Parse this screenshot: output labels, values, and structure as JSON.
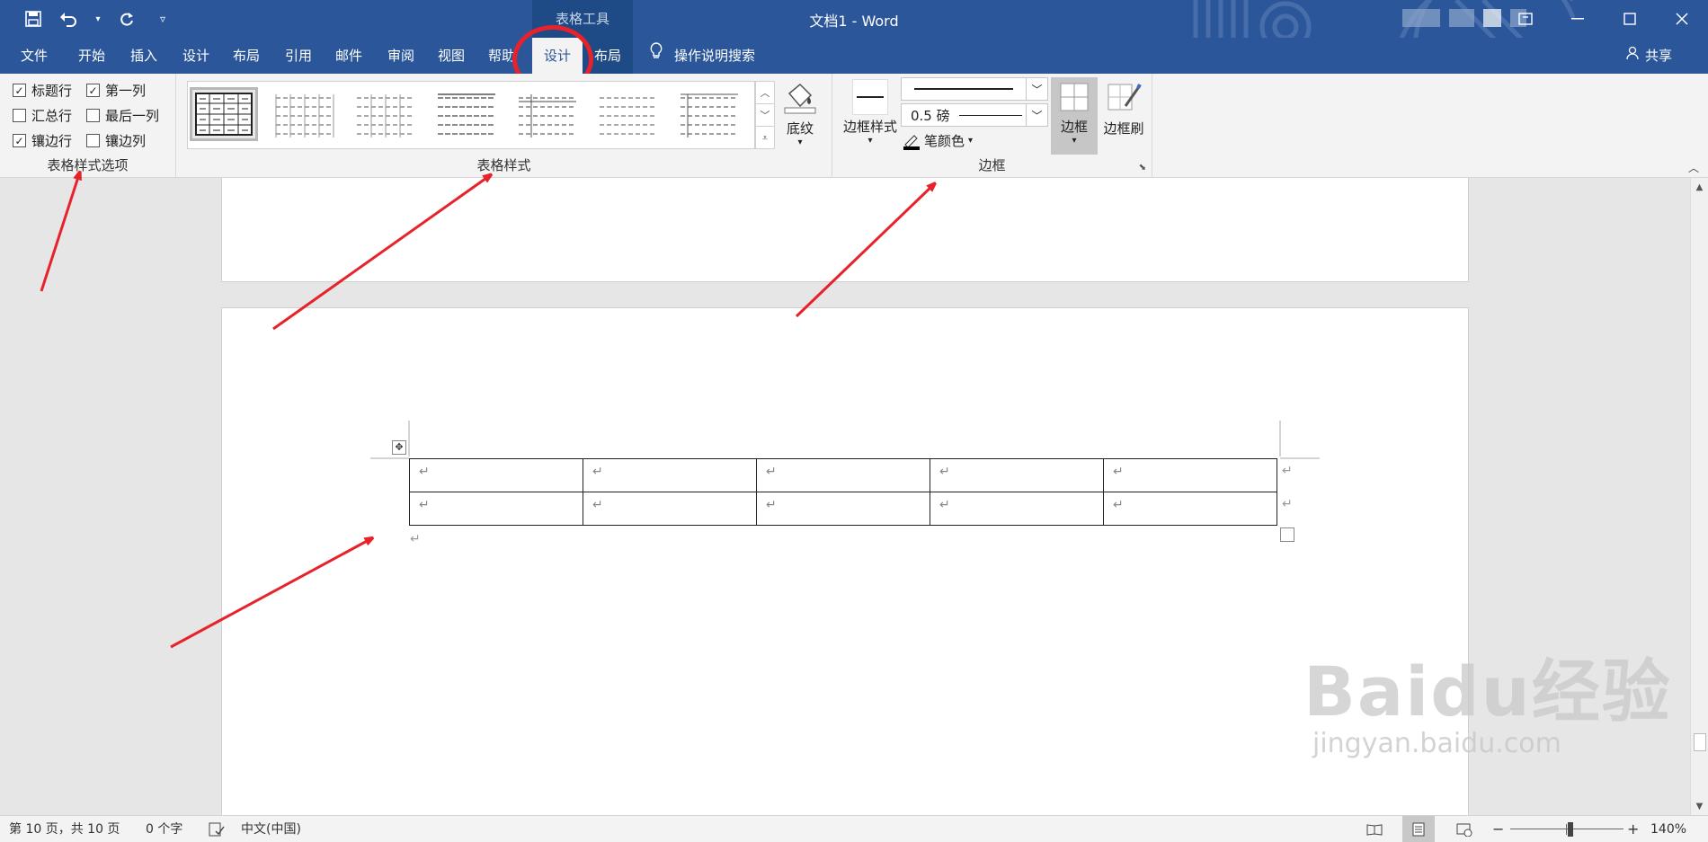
{
  "window": {
    "doc_title": "文档1  -  Word",
    "context_tab_label": "表格工具",
    "share_label": "共享"
  },
  "tabs": [
    {
      "label": "文件"
    },
    {
      "label": "开始"
    },
    {
      "label": "插入"
    },
    {
      "label": "设计"
    },
    {
      "label": "布局"
    },
    {
      "label": "引用"
    },
    {
      "label": "邮件"
    },
    {
      "label": "审阅"
    },
    {
      "label": "视图"
    },
    {
      "label": "帮助"
    },
    {
      "label": "设计"
    },
    {
      "label": "布局"
    }
  ],
  "tell_me": "操作说明搜索",
  "ribbon": {
    "style_options": {
      "label": "表格样式选项",
      "items": [
        {
          "label": "标题行",
          "checked": true
        },
        {
          "label": "第一列",
          "checked": true
        },
        {
          "label": "汇总行",
          "checked": false
        },
        {
          "label": "最后一列",
          "checked": false
        },
        {
          "label": "镶边行",
          "checked": true
        },
        {
          "label": "镶边列",
          "checked": false
        }
      ]
    },
    "table_styles": {
      "label": "表格样式",
      "shading_label": "底纹"
    },
    "borders": {
      "label": "边框",
      "border_styles_label": "边框样式",
      "weight_value": "0.5 磅",
      "pen_color_label": "笔颜色",
      "borders_label": "边框",
      "border_painter_label": "边框刷"
    }
  },
  "document": {
    "paragraph_mark": "↵"
  },
  "status": {
    "page": "第 10 页，共 10 页",
    "words": "0 个字",
    "language": "中文(中国)",
    "zoom": "140%"
  },
  "watermark": {
    "logo": "Baidu经验",
    "url": "jingyan.baidu.com"
  },
  "colors": {
    "title_bar": "#2b579a",
    "annotation": "#e8222b"
  }
}
